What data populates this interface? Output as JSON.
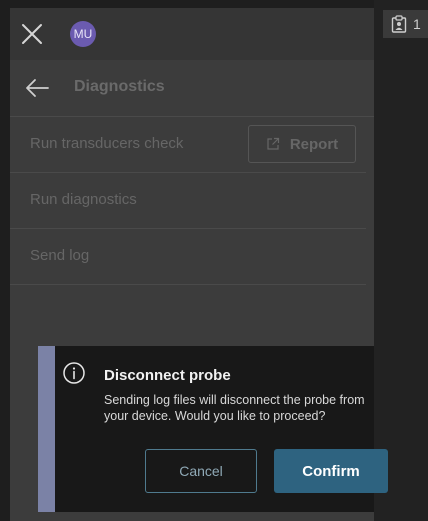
{
  "topbar": {
    "avatar_initials": "MU"
  },
  "right_panel": {
    "badge_count": "1"
  },
  "header": {
    "title": "Diagnostics"
  },
  "rows": [
    {
      "label": "Run transducers check",
      "button_label": "Report"
    },
    {
      "label": "Run diagnostics"
    },
    {
      "label": "Send log"
    }
  ],
  "dialog": {
    "title": "Disconnect probe",
    "body": "Sending log files will disconnect the probe from your device. Would you like to proceed?",
    "cancel_label": "Cancel",
    "confirm_label": "Confirm"
  },
  "colors": {
    "accent": "#2e6380",
    "dialog_stripe": "#7b82a6",
    "avatar": "#6b5bb0"
  },
  "icons": [
    "close-icon",
    "back-arrow-icon",
    "external-link-icon",
    "info-icon",
    "clipboard-user-icon"
  ]
}
